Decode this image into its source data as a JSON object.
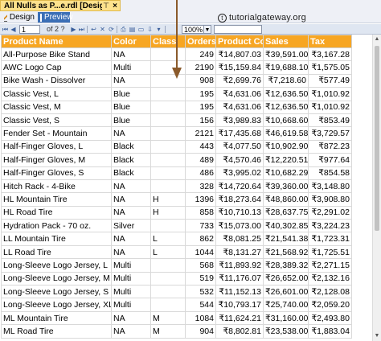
{
  "doc_tab": {
    "title": "All Nulls as P...e.rdl [Design]",
    "pin": "⊤",
    "close": "×"
  },
  "view_tabs": {
    "design": "Design",
    "preview": "Preview"
  },
  "watermark": {
    "symbol": "t",
    "text": "tutorialgateway.org"
  },
  "toolbar": {
    "page_current": "1",
    "page_of": "of 2 ?",
    "zoom": "100%",
    "find": ""
  },
  "colors": {
    "header_bg": "#f7a623",
    "header_text": "#ffffff",
    "preview_tab": "#3b6fb6"
  },
  "table": {
    "headers": [
      "Product Name",
      "Color",
      "Class",
      "Orders",
      "Product Cost",
      "Sales",
      "Tax"
    ],
    "rows": [
      [
        "All-Purpose Bike Stand",
        "NA",
        "",
        "249",
        "₹14,807.03",
        "₹39,591.00",
        "₹3,167.28"
      ],
      [
        "AWC Logo Cap",
        "Multi",
        "",
        "2190",
        "₹15,159.84",
        "₹19,688.10",
        "₹1,575.05"
      ],
      [
        "Bike Wash - Dissolver",
        "NA",
        "",
        "908",
        "₹2,699.76",
        "₹7,218.60",
        "₹577.49"
      ],
      [
        "Classic Vest, L",
        "Blue",
        "",
        "195",
        "₹4,631.06",
        "₹12,636.50",
        "₹1,010.92"
      ],
      [
        "Classic Vest, M",
        "Blue",
        "",
        "195",
        "₹4,631.06",
        "₹12,636.50",
        "₹1,010.92"
      ],
      [
        "Classic Vest, S",
        "Blue",
        "",
        "156",
        "₹3,989.83",
        "₹10,668.60",
        "₹853.49"
      ],
      [
        "Fender Set - Mountain",
        "NA",
        "",
        "2121",
        "₹17,435.68",
        "₹46,619.58",
        "₹3,729.57"
      ],
      [
        "Half-Finger Gloves, L",
        "Black",
        "",
        "443",
        "₹4,077.50",
        "₹10,902.90",
        "₹872.23"
      ],
      [
        "Half-Finger Gloves, M",
        "Black",
        "",
        "489",
        "₹4,570.46",
        "₹12,220.51",
        "₹977.64"
      ],
      [
        "Half-Finger Gloves, S",
        "Black",
        "",
        "486",
        "₹3,995.02",
        "₹10,682.29",
        "₹854.58"
      ],
      [
        "Hitch Rack - 4-Bike",
        "NA",
        "",
        "328",
        "₹14,720.64",
        "₹39,360.00",
        "₹3,148.80"
      ],
      [
        "HL Mountain Tire",
        "NA",
        "H",
        "1396",
        "₹18,273.64",
        "₹48,860.00",
        "₹3,908.80"
      ],
      [
        "HL Road Tire",
        "NA",
        "H",
        "858",
        "₹10,710.13",
        "₹28,637.75",
        "₹2,291.02"
      ],
      [
        "Hydration Pack - 70 oz.",
        "Silver",
        "",
        "733",
        "₹15,073.00",
        "₹40,302.85",
        "₹3,224.23"
      ],
      [
        "LL Mountain Tire",
        "NA",
        "L",
        "862",
        "₹8,081.25",
        "₹21,541.38",
        "₹1,723.31"
      ],
      [
        "LL Road Tire",
        "NA",
        "L",
        "1044",
        "₹8,131.27",
        "₹21,568.92",
        "₹1,725.51"
      ],
      [
        "Long-Sleeve Logo Jersey, L",
        "Multi",
        "",
        "568",
        "₹11,893.92",
        "₹28,389.32",
        "₹2,271.15"
      ],
      [
        "Long-Sleeve Logo Jersey, M",
        "Multi",
        "",
        "519",
        "₹11,176.07",
        "₹26,652.00",
        "₹2,132.16"
      ],
      [
        "Long-Sleeve Logo Jersey, S",
        "Multi",
        "",
        "532",
        "₹11,152.13",
        "₹26,601.00",
        "₹2,128.08"
      ],
      [
        "Long-Sleeve Logo Jersey, XL",
        "Multi",
        "",
        "544",
        "₹10,793.17",
        "₹25,740.00",
        "₹2,059.20"
      ],
      [
        "ML Mountain Tire",
        "NA",
        "M",
        "1084",
        "₹11,624.21",
        "₹31,160.00",
        "₹2,493.80"
      ],
      [
        "ML Road Tire",
        "NA",
        "M",
        "904",
        "₹8,802.81",
        "₹23,538.00",
        "₹1,883.04"
      ]
    ]
  }
}
